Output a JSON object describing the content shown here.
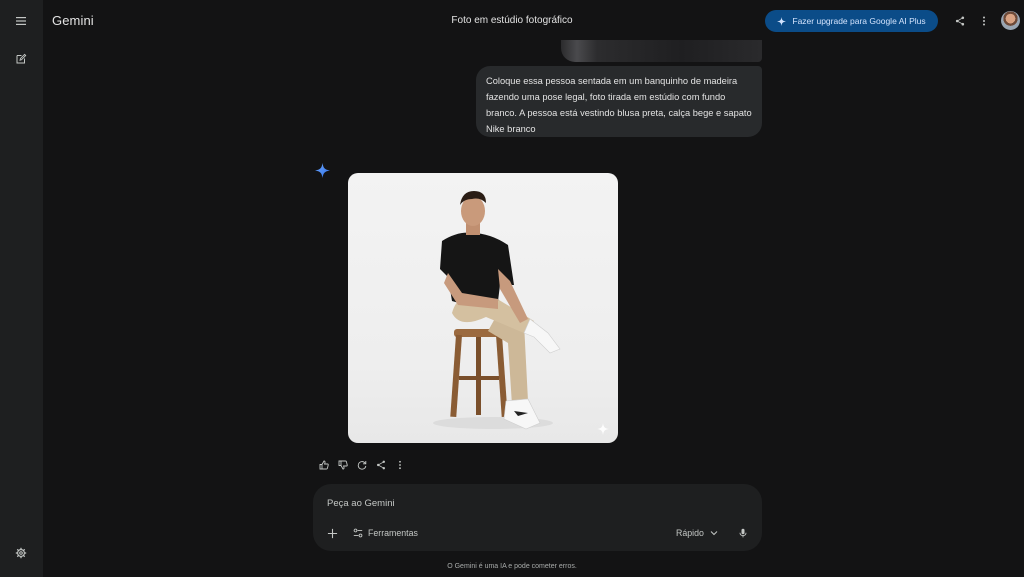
{
  "app": {
    "brand": "Gemini"
  },
  "header": {
    "title": "Foto em estúdio fotográfico",
    "upgrade_label": "Fazer upgrade para Google AI Plus"
  },
  "conversation": {
    "user_prompt": "Coloque essa pessoa sentada em um banquinho de madeira fazendo uma pose legal, foto tirada em estúdio com fundo branco. A pessoa está vestindo blusa preta, calça bege e sapato Nike branco"
  },
  "composer": {
    "placeholder": "Peça ao Gemini",
    "tools_label": "Ferramentas",
    "mode_label": "Rápido"
  },
  "footer": {
    "disclaimer": "O Gemini é uma IA e pode cometer erros."
  },
  "colors": {
    "background": "#131314",
    "rail": "#1e1f20",
    "bubble": "#282a2c",
    "upgrade_button": "#0b4c88",
    "gemini_blue": "#4f8ef7"
  },
  "icons": {
    "rail_top": "menu-icon",
    "rail_new_chat": "edit-icon",
    "rail_bottom": "settings-icon",
    "upgrade": "sparkle-icon",
    "share": "share-icon",
    "more": "more-vert-icon",
    "actions": [
      "thumb-up-icon",
      "thumb-down-icon",
      "refresh-icon",
      "share-icon",
      "more-vert-icon"
    ],
    "composer": [
      "plus-icon",
      "tune-icon",
      "chevron-down-icon",
      "mic-icon"
    ]
  }
}
